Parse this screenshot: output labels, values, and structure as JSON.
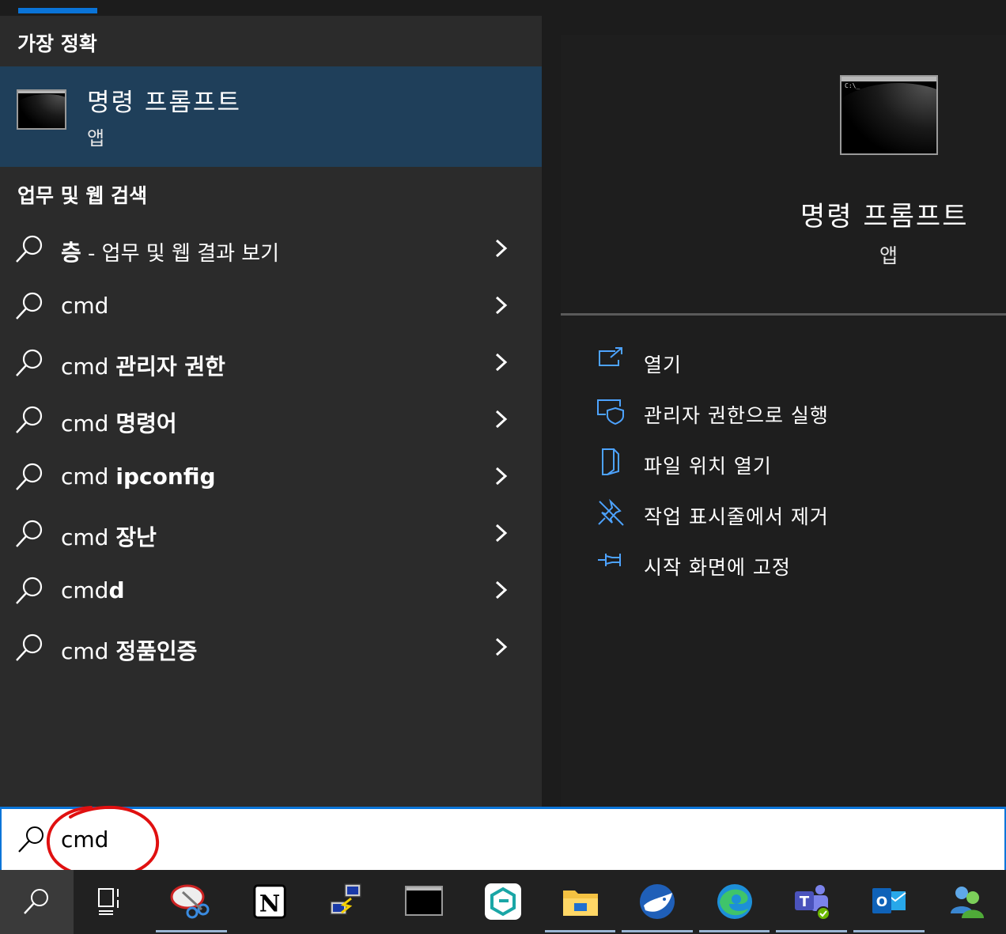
{
  "best_match": {
    "section_title": "가장 정확",
    "app_name": "명령 프롬프트",
    "app_type": "앱",
    "prompt_text": "C:\\_"
  },
  "web_search": {
    "section_title": "업무 및 웹 검색",
    "items": [
      {
        "prefix": "층",
        "suffix": " - 업무 및 웹 결과 보기"
      },
      {
        "prefix": "cmd",
        "suffix": ""
      },
      {
        "prefix": "cmd ",
        "suffix": "관리자 권한"
      },
      {
        "prefix": "cmd ",
        "suffix": "명령어"
      },
      {
        "prefix": "cmd ",
        "suffix": "ipconfig"
      },
      {
        "prefix": "cmd ",
        "suffix": "장난"
      },
      {
        "prefix": "cmd",
        "suffix": "d"
      },
      {
        "prefix": "cmd ",
        "suffix": "정품인증"
      }
    ]
  },
  "detail": {
    "app_name": "명령 프롬프트",
    "app_type": "앱",
    "actions": [
      {
        "label": "열기",
        "icon": "open-icon"
      },
      {
        "label": "관리자 권한으로 실행",
        "icon": "shield-icon"
      },
      {
        "label": "파일 위치 열기",
        "icon": "file-location-icon"
      },
      {
        "label": "작업 표시줄에서 제거",
        "icon": "unpin-icon"
      },
      {
        "label": "시작 화면에 고정",
        "icon": "pin-icon"
      }
    ]
  },
  "search": {
    "query": "cmd"
  },
  "taskbar": {
    "items": [
      "search-icon",
      "task-view-icon",
      "snipping-tool-icon",
      "notion-icon",
      "network-icon",
      "command-prompt-icon",
      "app-icon",
      "file-explorer-icon",
      "whale-browser-icon",
      "edge-icon",
      "teams-icon",
      "outlook-icon",
      "people-icon"
    ]
  },
  "colors": {
    "accent": "#0a74d8",
    "selected_bg": "#1f3f5a",
    "annotation": "#e01010"
  }
}
